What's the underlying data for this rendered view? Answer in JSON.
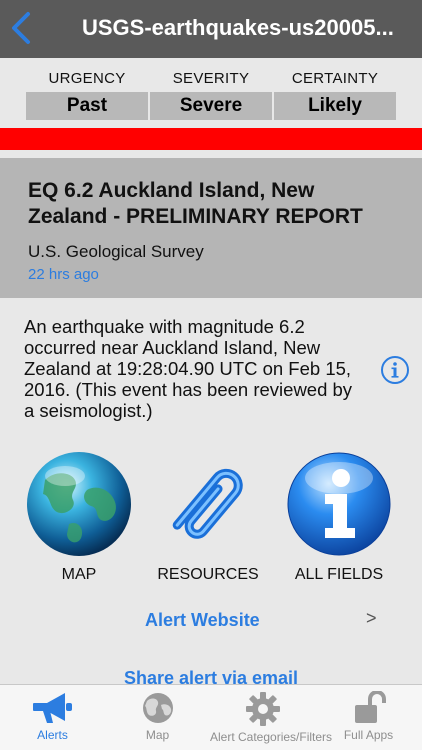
{
  "navbar": {
    "title": "USGS-earthquakes-us20005..."
  },
  "meta": {
    "urgency": {
      "label": "URGENCY",
      "value": "Past"
    },
    "severity": {
      "label": "SEVERITY",
      "value": "Severe"
    },
    "certainty": {
      "label": "CERTAINTY",
      "value": "Likely"
    }
  },
  "alert": {
    "title": "EQ 6.2 Auckland Island, New Zealand - PRELIMINARY REPORT",
    "source": "U.S. Geological Survey",
    "time": "22 hrs ago",
    "description": "An earthquake with magnitude 6.2 occurred near Auckland Island, New Zealand at 19:28:04.90 UTC on Feb 15, 2016. (This event has been reviewed by a seismologist.)"
  },
  "actions": {
    "map_label": "MAP",
    "resources_label": "RESOURCES",
    "all_fields_label": "ALL FIELDS",
    "alert_website": "Alert Website",
    "chevron": ">",
    "share_email": "Share alert via email"
  },
  "tabs": [
    {
      "label": "Alerts",
      "icon": "megaphone-icon"
    },
    {
      "label": "Map",
      "icon": "globe-icon"
    },
    {
      "label": "Alert Categories/Filters",
      "icon": "gear-icon"
    },
    {
      "label": "Full Apps",
      "icon": "unlock-icon"
    }
  ],
  "colors": {
    "accent": "#2c7de0",
    "navbar": "#5a5a5a",
    "severity_bar": "#ff0000"
  }
}
